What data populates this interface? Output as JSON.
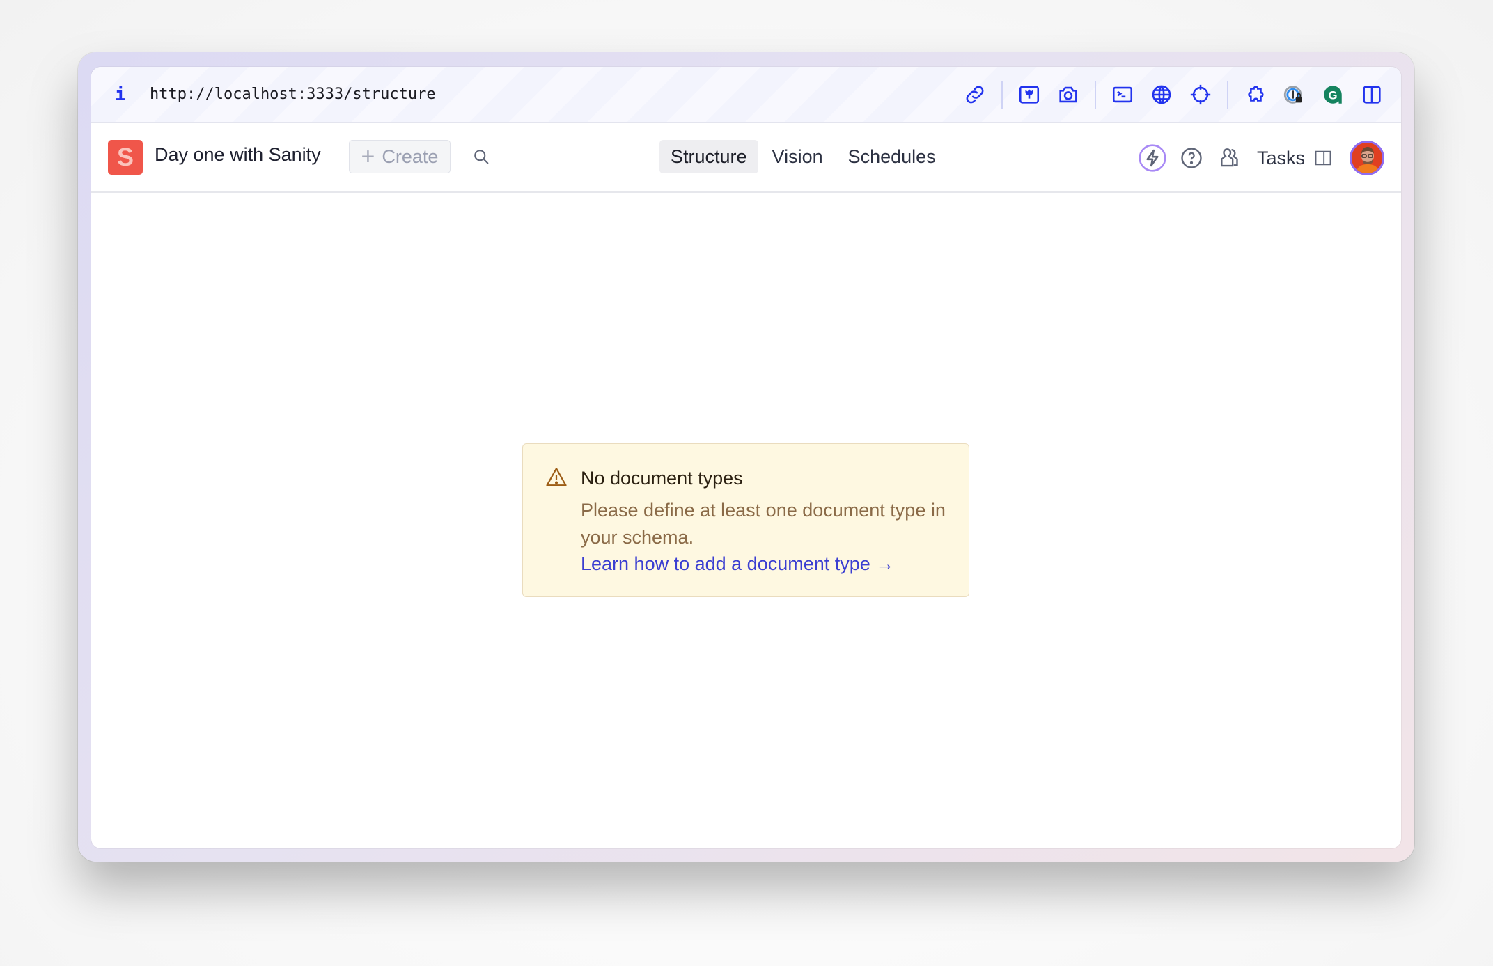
{
  "browser": {
    "info_icon": "info-icon",
    "url": "http://localhost:3333/structure",
    "toolbar_icons": [
      {
        "name": "link-icon"
      },
      {
        "name": "image-icon"
      },
      {
        "name": "camera-icon"
      },
      {
        "name": "terminal-icon"
      },
      {
        "name": "globe-icon"
      },
      {
        "name": "crosshair-icon"
      },
      {
        "name": "puzzle-extension-icon"
      },
      {
        "name": "password-manager-icon"
      },
      {
        "name": "grammarly-icon"
      },
      {
        "name": "split-view-icon"
      }
    ],
    "colors": {
      "accent": "#2233ee",
      "grammarly": "#15835f"
    }
  },
  "app": {
    "logo_letter": "S",
    "workspace_title": "Day one with Sanity",
    "create_label": "Create",
    "search_icon": "search-icon",
    "tabs": [
      {
        "label": "Structure",
        "active": true
      },
      {
        "label": "Vision",
        "active": false
      },
      {
        "label": "Schedules",
        "active": false
      }
    ],
    "right": {
      "bolt_icon": "lightning-icon",
      "help_icon": "help-circle-icon",
      "users_icon": "users-icon",
      "tasks_label": "Tasks",
      "panel_icon": "panel-icon",
      "avatar": "user-avatar"
    },
    "colors": {
      "logo": "#f0564a",
      "avatar_ring": "#8f6cf0"
    }
  },
  "notice": {
    "title": "No document types",
    "description": "Please define at least one document type in your schema.",
    "link_label": "Learn how to add a document type →",
    "colors": {
      "background": "#fef8e1",
      "border": "#eadcbe",
      "link": "#3b3fd1",
      "text": "#8a6a47"
    }
  }
}
